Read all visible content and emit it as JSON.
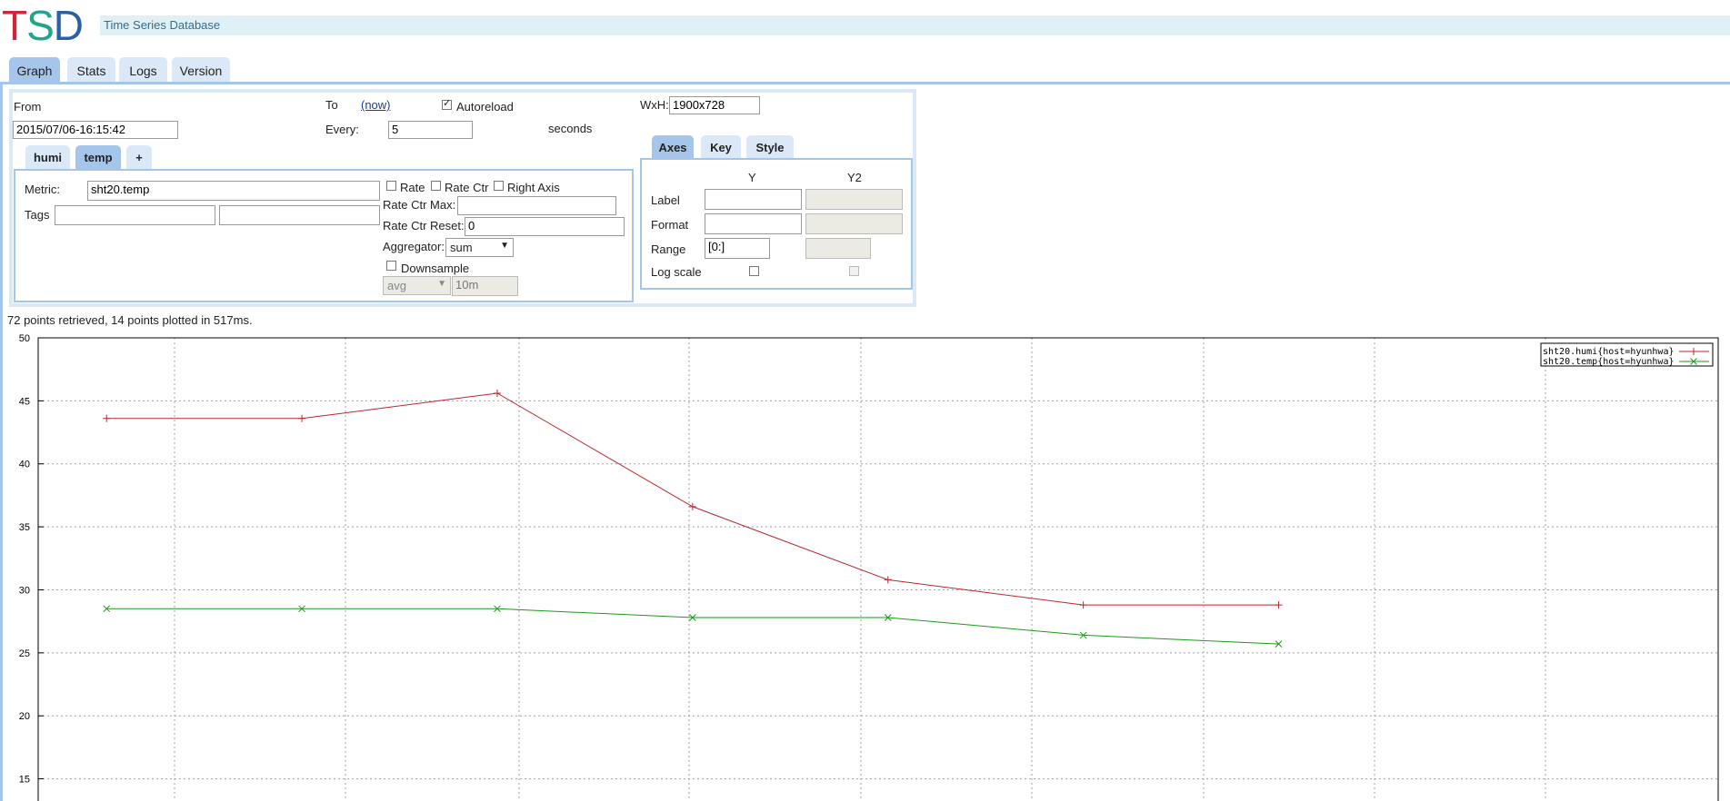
{
  "app": {
    "logo_letters": [
      {
        "char": "T",
        "color": "#d0263b"
      },
      {
        "char": "S",
        "color": "#21a58a"
      },
      {
        "char": "D",
        "color": "#2b5fa8"
      }
    ],
    "subtitle": "Time Series Database"
  },
  "tabs": [
    "Graph",
    "Stats",
    "Logs",
    "Version"
  ],
  "active_tab": "Graph",
  "query": {
    "from_label": "From",
    "from_value": "2015/07/06-16:15:42",
    "to_label": "To",
    "now_link": "(now)",
    "autoreload_label": "Autoreload",
    "autoreload_checked": true,
    "every_label": "Every:",
    "every_value": "5",
    "seconds_label": "seconds",
    "wxh_label": "WxH:",
    "wxh_value": "1900x728",
    "metric_tabs": [
      "humi",
      "temp",
      "+"
    ],
    "active_metric_tab": "temp",
    "metric_label": "Metric:",
    "metric_value": "sht20.temp",
    "tags_label": "Tags",
    "rate_label": "Rate",
    "rate_ctr_label": "Rate Ctr",
    "right_axis_label": "Right Axis",
    "rate_ctr_max_label": "Rate Ctr Max:",
    "rate_ctr_reset_label": "Rate Ctr Reset:",
    "rate_ctr_reset_value": "0",
    "aggregator_label": "Aggregator:",
    "aggregator_value": "sum",
    "downsample_label": "Downsample",
    "downsample_func": "avg",
    "downsample_interval": "10m"
  },
  "axes": {
    "tabs": [
      "Axes",
      "Key",
      "Style"
    ],
    "active_tab": "Axes",
    "col_y": "Y",
    "col_y2": "Y2",
    "label_row": "Label",
    "format_row": "Format",
    "range_row": "Range",
    "range_y_value": "[0:]",
    "log_scale_row": "Log scale"
  },
  "status": "72 points retrieved, 14 points plotted in 517ms.",
  "chart_data": {
    "type": "line",
    "ylim": [
      11.8,
      50
    ],
    "yticks": [
      15,
      20,
      25,
      30,
      35,
      40,
      45,
      50
    ],
    "grid": true,
    "legend_placement": "top-right",
    "series": [
      {
        "name": "sht20.humi{host=hyunhwa}",
        "color": "#c0262d",
        "marker": "+",
        "x": [
          0,
          2,
          4,
          6,
          8,
          10,
          12
        ],
        "y": [
          43.6,
          43.6,
          45.6,
          36.6,
          30.8,
          28.8,
          28.8
        ]
      },
      {
        "name": "sht20.temp{host=hyunhwa}",
        "color": "#1b9a1b",
        "marker": "x",
        "x": [
          0,
          2,
          4,
          6,
          8,
          10,
          12
        ],
        "y": [
          28.5,
          28.5,
          28.5,
          27.8,
          27.8,
          26.4,
          25.7
        ]
      }
    ]
  }
}
